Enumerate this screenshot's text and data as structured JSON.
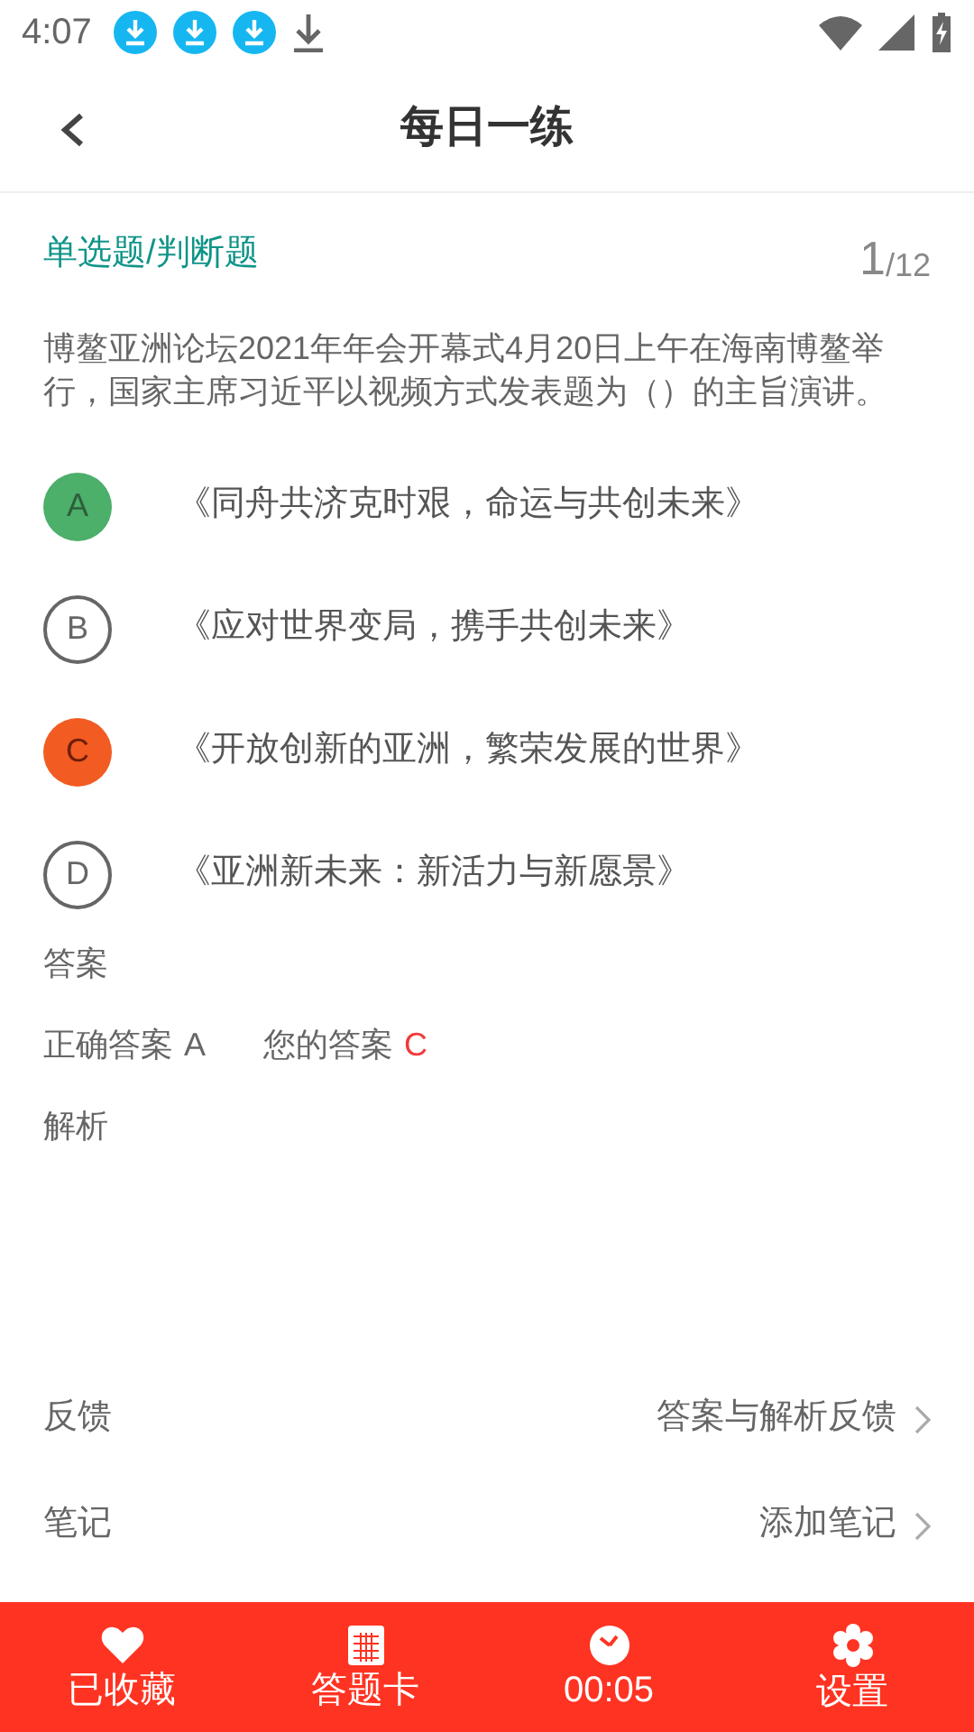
{
  "status_bar": {
    "time": "4:07"
  },
  "header": {
    "title": "每日一练"
  },
  "question": {
    "type_label": "单选题/判断题",
    "current": "1",
    "total": "/12",
    "text": "博鳌亚洲论坛2021年年会开幕式4月20日上午在海南博鳌举行，国家主席习近平以视频方式发表题为（）的主旨演讲。",
    "options": [
      {
        "letter": "A",
        "text": "《同舟共济克时艰，命运与共创未来》",
        "correct": true,
        "chosen": false
      },
      {
        "letter": "B",
        "text": "《应对世界变局，携手共创未来》",
        "correct": false,
        "chosen": false
      },
      {
        "letter": "C",
        "text": "《开放创新的亚洲，繁荣发展的世界》",
        "correct": false,
        "chosen": true
      },
      {
        "letter": "D",
        "text": "《亚洲新未来：新活力与新愿景》",
        "correct": false,
        "chosen": false
      }
    ]
  },
  "answer": {
    "heading": "答案",
    "correct_label": "正确答案",
    "correct_value": "A",
    "your_label": "您的答案",
    "your_value": "C",
    "analysis_heading": "解析"
  },
  "links": [
    {
      "label": "反馈",
      "action": "答案与解析反馈"
    },
    {
      "label": "笔记",
      "action": "添加笔记"
    }
  ],
  "bottom_bar": [
    {
      "kind": "favorite",
      "label": "已收藏"
    },
    {
      "kind": "card",
      "label": "答题卡"
    },
    {
      "kind": "timer",
      "label": "00:05"
    },
    {
      "kind": "settings",
      "label": "设置"
    }
  ]
}
